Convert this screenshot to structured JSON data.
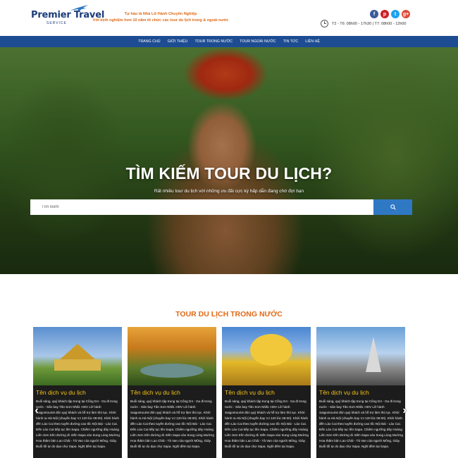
{
  "header": {
    "logo": {
      "name": "Premier Travel",
      "tagline": "SERVICE"
    },
    "slogan_line1": "Tự hào là Nhà Lữ Hành Chuyên Nghiệp",
    "slogan_line2": "Với kinh nghiệm hơn 10 năm tổ chức các tour du lịch trong & ngoài nước",
    "hours": "T2 - T6: 08h00 - 17h30 | T7: 08h00 - 12h00",
    "social": [
      {
        "icon": "facebook-icon",
        "glyph": "f"
      },
      {
        "icon": "pinterest-icon",
        "glyph": "p"
      },
      {
        "icon": "twitter-icon",
        "glyph": "t"
      },
      {
        "icon": "google-plus-icon",
        "glyph": "g+"
      }
    ]
  },
  "nav": {
    "items": [
      "TRANG CHỦ",
      "GIỚI THIỆU",
      "TOUR TRONG NƯỚC",
      "TOUR NGOÀI NƯỚC",
      "TIN TỨC",
      "LIÊN HỆ"
    ]
  },
  "hero": {
    "title": "TÌM KIẾM TOUR DU LỊCH?",
    "subtitle": "Rất nhiều tour du lịch với những ưu đãi cực kỳ hấp dẫn đang chờ đợi bạn",
    "search_placeholder": "Tìm kiếm"
  },
  "section": {
    "title": "TOUR DU LỊCH TRONG NƯỚC",
    "cards": [
      {
        "title": "Tên dịch vụ du lịch",
        "description": "Buổi sáng, quý khách tập trung tại Cổng D4 - Ga đi trong nước - Sân bay Tân Sơn Nhất. HDV Lữ hành Saigontourist đón quý khách và hỗ trợ làm thủ tục. Khởi hành ra Hà Nội (chuyến bay VJ 120 lúc 06:00). Khởi hành đến Lào Cai theo tuyến đường cao tốc Nội Bài - Lào Cai. Đến Lào Cai tiếp tục lên Sapa. Chiêm ngưỡng dãy Hoàng Liên Sơn trên đường đi. Đến Sapa vào trung Lùng Mường Hoa thăm bản Lao Chải - Tả Van của người Mông, Giáy. Buổi tối tự do dạo chợ Sapa. Nghỉ đêm tại Sapa."
      },
      {
        "title": "Tên dịch vụ du lịch",
        "description": "Buổi sáng, quý khách tập trung tại Cổng D4 - Ga đi trong nước - Sân bay Tân Sơn Nhất. HDV Lữ hành Saigontourist đón quý khách và hỗ trợ làm thủ tục. Khởi hành ra Hà Nội (chuyến bay VJ 120 lúc 06:00). Khởi hành đến Lào Cai theo tuyến đường cao tốc Nội Bài - Lào Cai. Đến Lào Cai tiếp tục lên Sapa. Chiêm ngưỡng dãy Hoàng Liên Sơn trên đường đi. Đến Sapa vào trung Lùng Mường Hoa thăm bản Lao Chải - Tả Van của người Mông, Giáy. Buổi tối tự do dạo chợ Sapa. Nghỉ đêm tại Sapa."
      },
      {
        "title": "Tên dịch vụ du lịch",
        "description": "Buổi sáng, quý khách tập trung tại Cổng D4 - Ga đi trong nước - Sân bay Tân Sơn Nhất. HDV Lữ hành Saigontourist đón quý khách và hỗ trợ làm thủ tục. Khởi hành ra Hà Nội (chuyến bay VJ 120 lúc 06:00). Khởi hành đến Lào Cai theo tuyến đường cao tốc Nội Bài - Lào Cai. Đến Lào Cai tiếp tục lên Sapa. Chiêm ngưỡng dãy Hoàng Liên Sơn trên đường đi. Đến Sapa vào trung Lùng Mường Hoa thăm bản Lao Chải - Tả Van của người Mông, Giáy. Buổi tối tự do dạo chợ Sapa. Nghỉ đêm tại Sapa."
      },
      {
        "title": "Tên dịch vụ du lịch",
        "description": "Buổi sáng, quý khách tập trung tại Cổng D4 - Ga đi trong nước - Sân bay Tân Sơn Nhất. HDV Lữ hành Saigontourist đón quý khách và hỗ trợ làm thủ tục. Khởi hành ra Hà Nội (chuyến bay VJ 120 lúc 06:00). Khởi hành đến Lào Cai theo tuyến đường cao tốc Nội Bài - Lào Cai. Đến Lào Cai tiếp tục lên Sapa. Chiêm ngưỡng dãy Hoàng Liên Sơn trên đường đi. Đến Sapa vào trung Lùng Mường Hoa thăm bản Lao Chải - Tả Van của người Mông, Giáy. Buổi tối tự do dạo chợ Sapa. Nghỉ đêm tại Sapa."
      }
    ],
    "prev_arrow": "‹",
    "next_arrow": "›"
  },
  "colors": {
    "nav_bg": "#1d4c92",
    "accent_orange": "#e06a17",
    "card_title": "#f3c21a",
    "search_button": "#2f78c4"
  }
}
